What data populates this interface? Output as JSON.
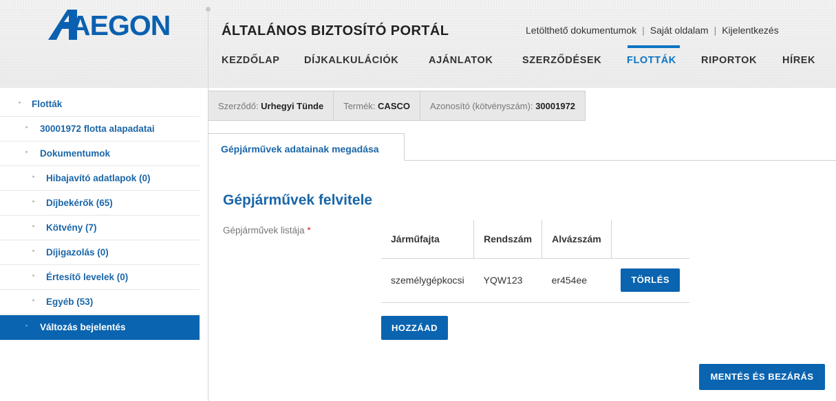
{
  "header": {
    "logo_text": "AEGON",
    "portal_title": "ÁLTALÁNOS BIZTOSÍTÓ PORTÁL",
    "top_links": [
      "Letölthető dokumentumok",
      "Saját oldalam",
      "Kijelentkezés"
    ],
    "nav": [
      "KEZDŐLAP",
      "DÍJKALKULÁCIÓK",
      "AJÁNLATOK",
      "SZERZŐDÉSEK",
      "FLOTTÁK",
      "RIPORTOK",
      "HÍREK"
    ],
    "active_nav": "FLOTTÁK",
    "brand_color": "#0a64b0"
  },
  "sidebar": {
    "items": [
      {
        "label": "Flották",
        "level": 0,
        "active": false
      },
      {
        "label": "30001972 flotta alapadatai",
        "level": 1,
        "active": false
      },
      {
        "label": "Dokumentumok",
        "level": 1,
        "active": false
      },
      {
        "label": "Hibajavító adatlapok (0)",
        "level": 2,
        "active": false
      },
      {
        "label": "Díjbekérők (65)",
        "level": 2,
        "active": false
      },
      {
        "label": "Kötvény (7)",
        "level": 2,
        "active": false
      },
      {
        "label": "Díjigazolás (0)",
        "level": 2,
        "active": false
      },
      {
        "label": "Értesítő levelek (0)",
        "level": 2,
        "active": false
      },
      {
        "label": "Egyéb (53)",
        "level": 2,
        "active": false
      },
      {
        "label": "Változás bejelentés",
        "level": 1,
        "active": true
      }
    ]
  },
  "infobar": {
    "contractor_label": "Szerződő:",
    "contractor_value": "Urhegyi Tünde",
    "product_label": "Termék:",
    "product_value": "CASCO",
    "id_label": "Azonosító (kötvényszám):",
    "id_value": "30001972"
  },
  "tab": {
    "label": "Gépjárművek adatainak megadása"
  },
  "main": {
    "section_title": "Gépjárművek felvitele",
    "field_label": "Gépjárművek listája",
    "required_mark": "*",
    "table": {
      "headers": [
        "Járműfajta",
        "Rendszám",
        "Alvázszám",
        ""
      ],
      "rows": [
        {
          "type": "személygépkocsi",
          "plate": "YQW123",
          "chassis": "er454ee",
          "delete_label": "TÖRLÉS"
        }
      ]
    },
    "add_label": "HOZZÁAD",
    "save_label": "MENTÉS ÉS BEZÁRÁS"
  }
}
